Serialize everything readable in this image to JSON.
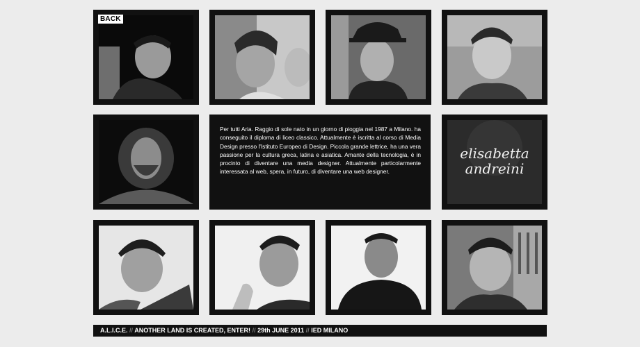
{
  "nav": {
    "back_label": "BACK"
  },
  "bio": {
    "text": "Per tutti Aria. Raggio di sole nato in un giorno di pioggia nel 1987 a Milano. ha conseguito il diploma di liceo classico. Attualmente è iscritta al corso di Media Design presso l'Istituto Europeo di Design. Piccola grande lettrice, ha una vera passione per la cultura greca, latina e asiatica. Amante della tecnologia, è in procinto di diventare una media designer. Attualmente particolarmente interessata al web, spera, in futuro, di diventare una web designer."
  },
  "name_card": {
    "first": "elisabetta",
    "last": "andreini"
  },
  "footer": {
    "parts": [
      "A.L.I.C.E.",
      "ANOTHER LAND IS CREATED, ENTER!",
      "29th JUNE 2011",
      "IED MILANO"
    ],
    "separator": "//"
  },
  "colors": {
    "page_bg": "#ececec",
    "tile_bg": "#111111",
    "footer_sep": "#7a7a7a"
  }
}
